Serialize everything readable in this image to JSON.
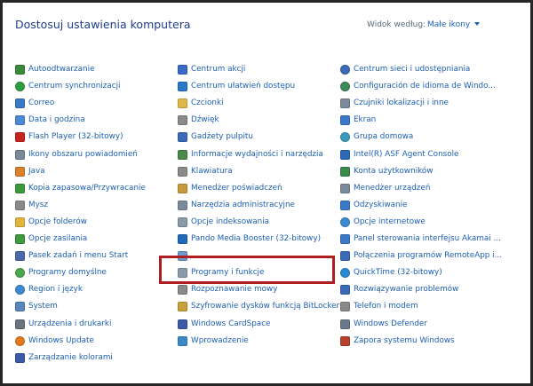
{
  "header": {
    "title": "Dostosuj ustawienia komputera",
    "view_by_label": "Widok według:",
    "view_by_value": "Małe ikony"
  },
  "highlight_color": "#b01e22",
  "columns": [
    {
      "items": [
        {
          "label": "Autoodtwarzanie",
          "icon": "autoplay-icon",
          "color": "#3a8a3a"
        },
        {
          "label": "Centrum synchronizacji",
          "icon": "sync-center-icon",
          "color": "#2e9e3e"
        },
        {
          "label": "Correo",
          "icon": "mail-icon",
          "color": "#3a78c8"
        },
        {
          "label": "Data i godzina",
          "icon": "clock-icon",
          "color": "#4d8ad6"
        },
        {
          "label": "Flash Player (32-bitowy)",
          "icon": "flash-icon",
          "color": "#c8241e"
        },
        {
          "label": "Ikony obszaru powiadomień",
          "icon": "notification-icons-icon",
          "color": "#7a8898"
        },
        {
          "label": "Java",
          "icon": "java-icon",
          "color": "#d9822b"
        },
        {
          "label": "Kopia zapasowa/Przywracanie",
          "icon": "backup-icon",
          "color": "#3c9a3c"
        },
        {
          "label": "Mysz",
          "icon": "mouse-icon",
          "color": "#8a8a8a"
        },
        {
          "label": "Opcje folderów",
          "icon": "folder-icon",
          "color": "#e3b43a"
        },
        {
          "label": "Opcje zasilania",
          "icon": "power-icon",
          "color": "#3f9a3f"
        },
        {
          "label": "Pasek zadań i menu Start",
          "icon": "taskbar-icon",
          "color": "#4a6aa8"
        },
        {
          "label": "Programy domyślne",
          "icon": "default-programs-icon",
          "color": "#4aa84a"
        },
        {
          "label": "Region i język",
          "icon": "globe-icon",
          "color": "#3c8ad0"
        },
        {
          "label": "System",
          "icon": "system-icon",
          "color": "#5a86c0"
        },
        {
          "label": "Urządzenia i drukarki",
          "icon": "printer-icon",
          "color": "#6a7480"
        },
        {
          "label": "Windows Update",
          "icon": "windows-update-icon",
          "color": "#e07a1a"
        },
        {
          "label": "Zarządzanie kolorami",
          "icon": "color-management-icon",
          "color": "#3a5aa8"
        }
      ]
    },
    {
      "items": [
        {
          "label": "Centrum akcji",
          "icon": "flag-icon",
          "color": "#3a6ac8"
        },
        {
          "label": "Centrum ułatwień dostępu",
          "icon": "accessibility-icon",
          "color": "#2a78c8"
        },
        {
          "label": "Czcionki",
          "icon": "fonts-icon",
          "color": "#e0b84a"
        },
        {
          "label": "Dźwięk",
          "icon": "speaker-icon",
          "color": "#8a8a8a"
        },
        {
          "label": "Gadżety pulpitu",
          "icon": "gadgets-icon",
          "color": "#3a6ab8"
        },
        {
          "label": "Informacje wydajności i narzędzia",
          "icon": "performance-icon",
          "color": "#4a8a4a"
        },
        {
          "label": "Klawiatura",
          "icon": "keyboard-icon",
          "color": "#8a8a8a"
        },
        {
          "label": "Menedżer poświadczeń",
          "icon": "credentials-icon",
          "color": "#c89a3a"
        },
        {
          "label": "Narzędzia administracyjne",
          "icon": "admin-tools-icon",
          "color": "#7a8a9a"
        },
        {
          "label": "Opcje indeksowania",
          "icon": "indexing-icon",
          "color": "#8a9aa8"
        },
        {
          "label": "Pando Media Booster (32-bitowy)",
          "icon": "pando-icon",
          "color": "#1e6ab8"
        },
        {
          "label": "",
          "icon": "personalization-icon",
          "color": "#6a9ad0"
        },
        {
          "label": "Programy i funkcje",
          "icon": "programs-features-icon",
          "color": "#8a9aa8"
        },
        {
          "label": "Rozpoznawanie mowy",
          "icon": "microphone-icon",
          "color": "#8a8a8a"
        },
        {
          "label": "Szyfrowanie dysków funkcją BitLocker",
          "icon": "bitlocker-icon",
          "color": "#c8a03a"
        },
        {
          "label": "Windows CardSpace",
          "icon": "cardspace-icon",
          "color": "#3a5aa8"
        },
        {
          "label": "Wprowadzenie",
          "icon": "getting-started-icon",
          "color": "#3a8ac8"
        }
      ]
    },
    {
      "items": [
        {
          "label": "Centrum sieci i udostępniania",
          "icon": "network-icon",
          "color": "#3a6ab8"
        },
        {
          "label": "Configuración de idioma de Windo...",
          "icon": "language-icon",
          "color": "#3a8a5a"
        },
        {
          "label": "Czujniki lokalizacji i inne",
          "icon": "sensors-icon",
          "color": "#7a8a9a"
        },
        {
          "label": "Ekran",
          "icon": "display-icon",
          "color": "#3a7ac8"
        },
        {
          "label": "Grupa domowa",
          "icon": "homegroup-icon",
          "color": "#3a9ab8"
        },
        {
          "label": "Intel(R) ASF Agent Console",
          "icon": "intel-icon",
          "color": "#2a6ab8"
        },
        {
          "label": "Konta użytkowników",
          "icon": "users-icon",
          "color": "#3a8a4a"
        },
        {
          "label": "Menedżer urządzeń",
          "icon": "device-manager-icon",
          "color": "#7a8a9a"
        },
        {
          "label": "Odzyskiwanie",
          "icon": "recovery-icon",
          "color": "#3a7ac8"
        },
        {
          "label": "Opcje internetowe",
          "icon": "internet-options-icon",
          "color": "#3a8ad0"
        },
        {
          "label": "Panel sterowania interfejsu Akamai ...",
          "icon": "akamai-icon",
          "color": "#3a78c8"
        },
        {
          "label": "Połączenia programów RemoteApp i...",
          "icon": "remoteapp-icon",
          "color": "#3a6ab8"
        },
        {
          "label": "QuickTime (32-bitowy)",
          "icon": "quicktime-icon",
          "color": "#2a8ad0"
        },
        {
          "label": "Rozwiązywanie problemów",
          "icon": "troubleshooting-icon",
          "color": "#3a6ab8"
        },
        {
          "label": "Telefon i modem",
          "icon": "phone-icon",
          "color": "#8a8a8a"
        },
        {
          "label": "Windows Defender",
          "icon": "defender-icon",
          "color": "#6a7a8a"
        },
        {
          "label": "Zapora systemu Windows",
          "icon": "firewall-icon",
          "color": "#b8422a"
        }
      ]
    }
  ]
}
